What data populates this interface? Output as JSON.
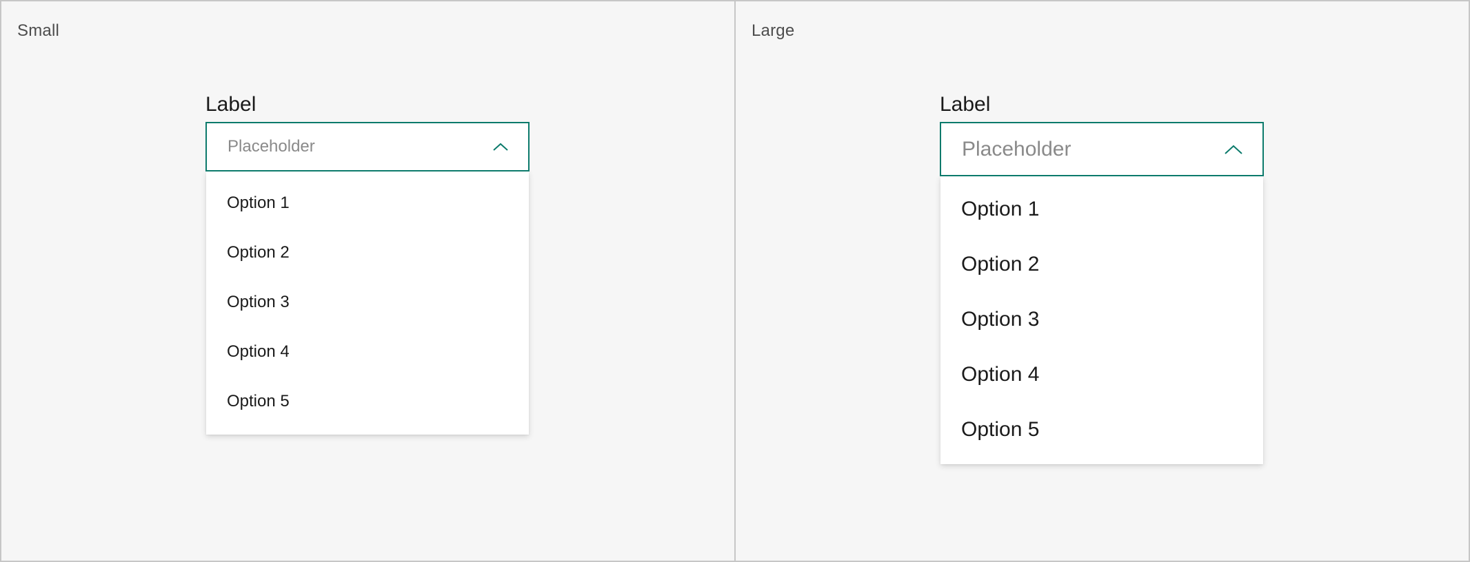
{
  "colors": {
    "accent": "#0b7a6b",
    "background": "#f6f6f6",
    "menu_background": "#ffffff",
    "placeholder": "#8a8a8a"
  },
  "panels": [
    {
      "title": "Small",
      "dropdown": {
        "label": "Label",
        "placeholder": "Placeholder",
        "chevron_icon": "chevron-up-icon",
        "options": [
          "Option 1",
          "Option 2",
          "Option 3",
          "Option 4",
          "Option 5"
        ]
      }
    },
    {
      "title": "Large",
      "dropdown": {
        "label": "Label",
        "placeholder": "Placeholder",
        "chevron_icon": "chevron-up-icon",
        "options": [
          "Option 1",
          "Option 2",
          "Option 3",
          "Option 4",
          "Option 5"
        ]
      }
    }
  ]
}
